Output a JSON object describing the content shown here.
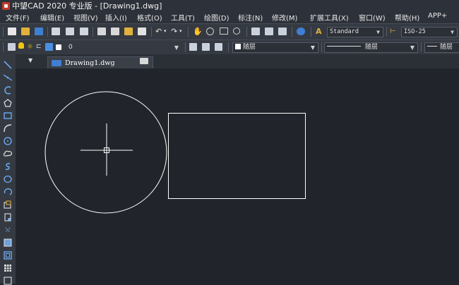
{
  "window": {
    "title": "中望CAD 2020 专业版 - [Drawing1.dwg]"
  },
  "menu": [
    "文件(F)",
    "编辑(E)",
    "视图(V)",
    "插入(I)",
    "格式(O)",
    "工具(T)",
    "绘图(D)",
    "标注(N)",
    "修改(M)",
    "扩展工具(X)",
    "窗口(W)",
    "帮助(H)",
    "APP+"
  ],
  "toolbar1": {
    "text_style": "Standard",
    "dim_style": "ISO-25"
  },
  "toolbar2": {
    "layer_name": "0",
    "color": "随层",
    "linetype": "随层",
    "lineweight": "随层"
  },
  "tabs": {
    "drawing_tab_label": "Drawing1.dwg",
    "close_glyph": "✕"
  },
  "colors": {
    "canvas_bg": "#21252b",
    "entity_stroke": "#ffffff",
    "toolbar_bg": "#353a42"
  },
  "icons": {
    "toolbar1": [
      "new-file-icon",
      "open-folder-icon",
      "save-icon",
      "print-icon",
      "print-preview-icon",
      "plot-icon",
      "cut-icon",
      "copy-icon",
      "paste-icon",
      "match-properties-icon",
      "undo-icon",
      "redo-icon",
      "pan-icon",
      "zoom-realtime-icon",
      "zoom-window-icon",
      "zoom-previous-icon",
      "properties-icon",
      "design-center-icon",
      "tool-palette-icon",
      "help-icon",
      "text-style-icon",
      "dimension-style-icon"
    ],
    "left_toolbar": [
      "line-icon",
      "construction-line-icon",
      "polyline-icon",
      "polygon-icon",
      "rectangle-icon",
      "arc-icon",
      "circle-icon",
      "revision-cloud-icon",
      "spline-icon",
      "ellipse-icon",
      "ellipse-arc-icon",
      "insert-block-icon",
      "make-block-icon",
      "point-icon",
      "hatch-icon",
      "region-icon",
      "table-icon",
      "multiline-text-icon"
    ]
  }
}
